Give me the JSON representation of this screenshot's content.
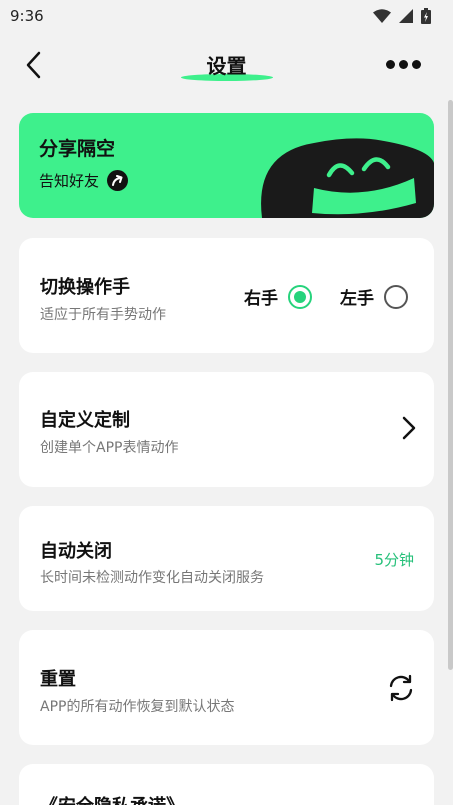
{
  "status_bar": {
    "time": "9:36"
  },
  "header": {
    "title": "设置"
  },
  "share": {
    "title": "分享隔空",
    "subtitle": "告知好友"
  },
  "hand": {
    "title": "切换操作手",
    "subtitle": "适应于所有手势动作",
    "right_label": "右手",
    "left_label": "左手",
    "selected": "右手"
  },
  "custom": {
    "title": "自定义定制",
    "subtitle": "创建单个APP表情动作"
  },
  "auto_close": {
    "title": "自动关闭",
    "subtitle": "长时间未检测动作变化自动关闭服务",
    "value": "5分钟"
  },
  "reset": {
    "title": "重置",
    "subtitle": "APP的所有动作恢复到默认状态"
  },
  "privacy": {
    "title": "《安全隐私承诺》"
  },
  "colors": {
    "accent": "#3ef08c",
    "value_green": "#26c07a",
    "background": "#f2f2f2"
  }
}
